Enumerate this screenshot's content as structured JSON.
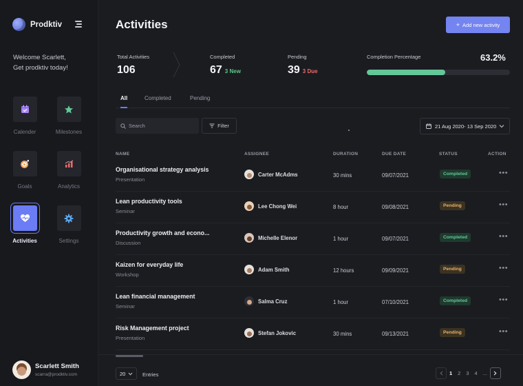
{
  "brand": {
    "name": "Prodktiv"
  },
  "sidebar": {
    "welcome_line1": "Welcome Scarlett,",
    "welcome_line2": "Get prodktiv today!",
    "items": [
      {
        "label": "Calender",
        "icon": "calendar-icon",
        "color": "#a887f0",
        "active": false
      },
      {
        "label": "Milestones",
        "icon": "star-icon",
        "color": "#62c996",
        "active": false
      },
      {
        "label": "Goals",
        "icon": "target-icon",
        "color": "#f0a35a",
        "active": false
      },
      {
        "label": "Analytics",
        "icon": "chart-icon",
        "color": "#ef6a6a",
        "active": false
      },
      {
        "label": "Activities",
        "icon": "heart-pulse-icon",
        "color": "#ffffff",
        "active": true
      },
      {
        "label": "Settings",
        "icon": "gear-icon",
        "color": "#5aa9f0",
        "active": false
      }
    ]
  },
  "user": {
    "name": "Scarlett Smith",
    "email": "scarra@prodktiv.com"
  },
  "header": {
    "title": "Activities",
    "add_button": "Add new activity"
  },
  "stats": {
    "total_label": "Total Activities",
    "total_value": "106",
    "completed_label": "Completed",
    "completed_value": "67",
    "completed_sub": "3 New",
    "pending_label": "Pending",
    "pending_value": "39",
    "pending_sub": "3 Due",
    "pct_label": "Completion Percentage",
    "pct_value": "63.2%",
    "pct_fraction": 0.55
  },
  "tabs": [
    "All",
    "Completed",
    "Pending"
  ],
  "toolbar": {
    "search_placeholder": "Search",
    "filter_label": "Filter",
    "date_range": "21 Aug 2020- 13 Sep 2020"
  },
  "table": {
    "headers": {
      "name": "NAME",
      "assignee": "ASSIGNEE",
      "duration": "DURATION",
      "due": "DUE DATE",
      "status": "STATUS",
      "action": "ACTION"
    },
    "rows": [
      {
        "title": "Organisational strategy analysis",
        "category": "Presentation",
        "assignee": "Carter McAdms",
        "duration": "30 mins",
        "due": "09/07/2021",
        "status": "Completed"
      },
      {
        "title": "Lean productivity tools",
        "category": "Seminar",
        "assignee": "Lee Chong Wei",
        "duration": "8 hour",
        "due": "09/08/2021",
        "status": "Pending"
      },
      {
        "title": "Productivity growth and econo...",
        "category": "Discussion",
        "assignee": "Michelle Elenor",
        "duration": "1 hour",
        "due": "09/07/2021",
        "status": "Completed"
      },
      {
        "title": "Kaizen for everyday life",
        "category": "Workshop",
        "assignee": "Adam Smith",
        "duration": "12 hours",
        "due": "09/09/2021",
        "status": "Pending"
      },
      {
        "title": "Lean financial management",
        "category": "Seminar",
        "assignee": "Salma Cruz",
        "duration": "1 hour",
        "due": "07/10/2021",
        "status": "Completed"
      },
      {
        "title": "Risk Management project",
        "category": "Presentation",
        "assignee": "Stefan Jokovic",
        "duration": "30 mins",
        "due": "09/13/2021",
        "status": "Pending"
      }
    ],
    "more_glyph": "•••"
  },
  "footer": {
    "per_page": "20",
    "entries_label": "Entries",
    "pages": [
      "1",
      "2",
      "3",
      "4"
    ],
    "ellipsis": "..."
  },
  "colors": {
    "accent": "#6b7cf4",
    "success": "#63c898",
    "warning": "#e8b16a",
    "danger": "#ef6a6a"
  }
}
